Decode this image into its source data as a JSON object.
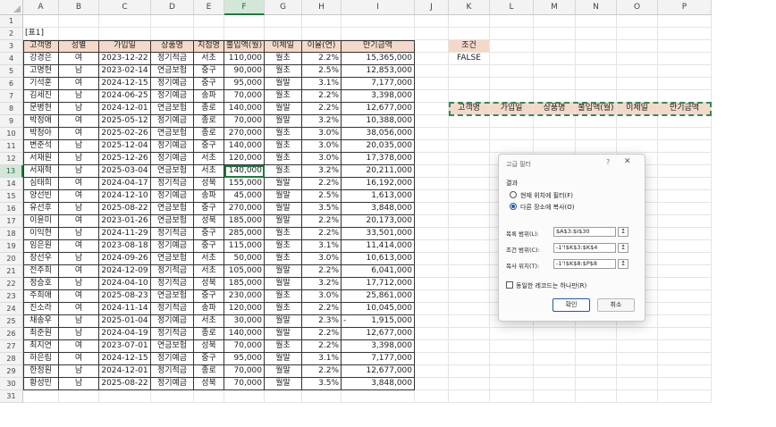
{
  "columns": [
    "A",
    "B",
    "C",
    "D",
    "E",
    "F",
    "G",
    "H",
    "I",
    "J",
    "K",
    "L",
    "M",
    "N",
    "O",
    "P"
  ],
  "row_numbers": [
    "1",
    "2",
    "3",
    "4",
    "5",
    "6",
    "7",
    "8",
    "9",
    "10",
    "11",
    "12",
    "13",
    "14",
    "15",
    "16",
    "17",
    "18",
    "19",
    "20",
    "21",
    "22",
    "23",
    "24",
    "25",
    "26",
    "27",
    "28",
    "29",
    "30",
    "31"
  ],
  "table_label": "[표1]",
  "headers": [
    "고객명",
    "성별",
    "가입일",
    "상품명",
    "지점명",
    "불입액(월)",
    "이체일",
    "이율(연)",
    "만기금액"
  ],
  "rows": [
    [
      "강경은",
      "여",
      "2023-12-22",
      "정기적금",
      "서초",
      "110,000",
      "월초",
      "2.2%",
      "15,365,000"
    ],
    [
      "고명현",
      "남",
      "2023-02-14",
      "연금보험",
      "중구",
      "90,000",
      "월초",
      "2.5%",
      "12,853,000"
    ],
    [
      "기석훈",
      "여",
      "2024-12-15",
      "정기예금",
      "중구",
      "95,000",
      "월말",
      "3.1%",
      "7,177,000"
    ],
    [
      "김세진",
      "남",
      "2024-06-25",
      "정기예금",
      "송파",
      "70,000",
      "월초",
      "2.2%",
      "3,398,000"
    ],
    [
      "문병현",
      "남",
      "2024-12-01",
      "연금보험",
      "종로",
      "140,000",
      "월말",
      "2.2%",
      "12,677,000"
    ],
    [
      "박정애",
      "여",
      "2025-05-12",
      "정기예금",
      "종로",
      "70,000",
      "월말",
      "3.2%",
      "10,388,000"
    ],
    [
      "박청아",
      "여",
      "2025-02-26",
      "연금보험",
      "종로",
      "270,000",
      "월초",
      "3.0%",
      "38,056,000"
    ],
    [
      "변준석",
      "남",
      "2025-12-04",
      "정기예금",
      "중구",
      "140,000",
      "월초",
      "3.0%",
      "20,035,000"
    ],
    [
      "서재원",
      "남",
      "2025-12-26",
      "정기예금",
      "서초",
      "120,000",
      "월초",
      "3.0%",
      "17,378,000"
    ],
    [
      "서재혁",
      "남",
      "2025-03-04",
      "연금보험",
      "서초",
      "140,000",
      "월초",
      "3.2%",
      "20,211,000"
    ],
    [
      "심태희",
      "여",
      "2024-04-17",
      "정기적금",
      "성북",
      "155,000",
      "월말",
      "2.2%",
      "16,192,000"
    ],
    [
      "양선빈",
      "여",
      "2024-12-10",
      "정기예금",
      "송파",
      "45,000",
      "월말",
      "2.5%",
      "1,613,000"
    ],
    [
      "유선후",
      "남",
      "2025-08-22",
      "연금보험",
      "중구",
      "270,000",
      "월말",
      "3.5%",
      "3,848,000"
    ],
    [
      "이윤미",
      "여",
      "2023-01-26",
      "연금보험",
      "성북",
      "185,000",
      "월말",
      "2.2%",
      "20,173,000"
    ],
    [
      "이익현",
      "남",
      "2024-11-29",
      "정기적금",
      "중구",
      "285,000",
      "월초",
      "2.2%",
      "33,501,000"
    ],
    [
      "임은원",
      "여",
      "2023-08-18",
      "정기예금",
      "중구",
      "115,000",
      "월초",
      "3.1%",
      "11,414,000"
    ],
    [
      "장선우",
      "남",
      "2024-09-26",
      "연금보험",
      "서초",
      "50,000",
      "월초",
      "3.0%",
      "10,613,000"
    ],
    [
      "전주희",
      "여",
      "2024-12-09",
      "정기적금",
      "서초",
      "105,000",
      "월말",
      "2.2%",
      "6,041,000"
    ],
    [
      "정승호",
      "남",
      "2024-04-10",
      "정기적금",
      "성북",
      "185,000",
      "월말",
      "3.2%",
      "17,712,000"
    ],
    [
      "주희애",
      "여",
      "2025-08-23",
      "연금보험",
      "중구",
      "230,000",
      "월초",
      "3.0%",
      "25,861,000"
    ],
    [
      "진소라",
      "여",
      "2024-11-14",
      "정기적금",
      "송파",
      "120,000",
      "월초",
      "2.2%",
      "10,045,000"
    ],
    [
      "채송우",
      "남",
      "2025-01-04",
      "정기예금",
      "서초",
      "30,000",
      "월말",
      "2.3%",
      "1,915,000"
    ],
    [
      "최준원",
      "남",
      "2024-04-19",
      "정기적금",
      "종로",
      "140,000",
      "월말",
      "2.2%",
      "12,677,000"
    ],
    [
      "최지연",
      "여",
      "2023-07-01",
      "연금보험",
      "성북",
      "70,000",
      "월초",
      "2.2%",
      "3,398,000"
    ],
    [
      "하은림",
      "여",
      "2024-12-15",
      "정기예금",
      "중구",
      "95,000",
      "월말",
      "3.1%",
      "7,177,000"
    ],
    [
      "한정원",
      "남",
      "2024-12-01",
      "정기적금",
      "종로",
      "70,000",
      "월말",
      "2.2%",
      "12,677,000"
    ],
    [
      "황성민",
      "남",
      "2025-08-22",
      "정기예금",
      "성북",
      "70,000",
      "월말",
      "3.5%",
      "3,848,000"
    ]
  ],
  "i25_prefix": "-",
  "condition": {
    "header": "조건",
    "value": "FALSE"
  },
  "copy_headers": [
    "고객명",
    "가입일",
    "상품명",
    "불입액(월)",
    "이체일",
    "만기금액"
  ],
  "dialog": {
    "title": "고급 필터",
    "help": "?",
    "close": "✕",
    "section": "결과",
    "radio1": "현재 위치에 필터(F)",
    "radio2": "다른 장소에 복사(O)",
    "list_range_label": "목록 범위(L):",
    "list_range_value": "$A$3:$I$30",
    "criteria_range_label": "조건 범위(C):",
    "criteria_range_value": "-1'!$K$3:$K$4",
    "copy_to_label": "복사 위치(T):",
    "copy_to_value": "-1'!$K$8:$P$8",
    "unique_label": "동일한 레코드는 하나만(R)",
    "ok": "확인",
    "cancel": "취소",
    "ref_icon": "↥"
  }
}
